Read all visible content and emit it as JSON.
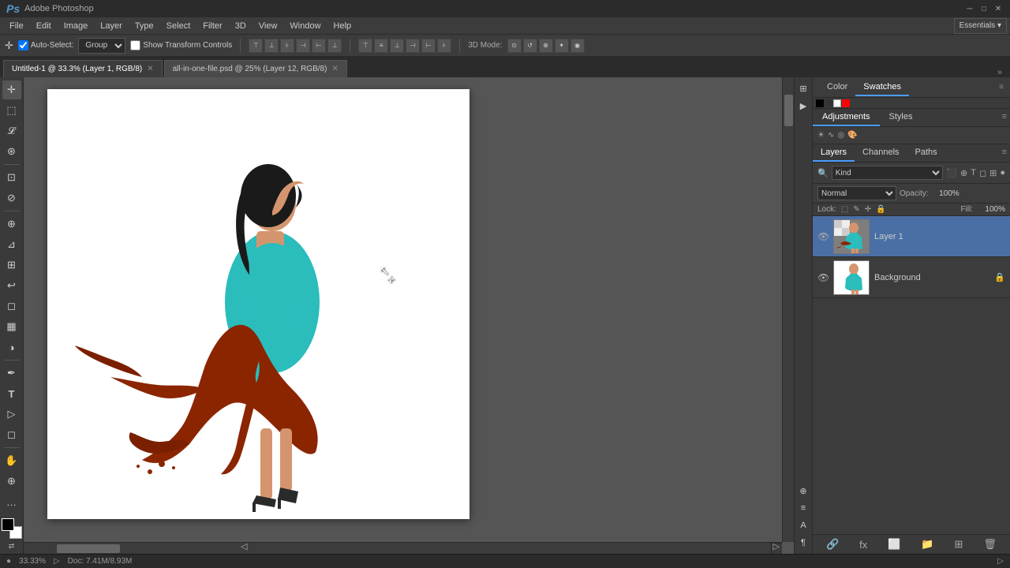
{
  "app": {
    "logo": "Ps",
    "title": "Adobe Photoshop",
    "essentials": "Essentials ▾"
  },
  "menubar": {
    "items": [
      "File",
      "Edit",
      "Image",
      "Layer",
      "Type",
      "Select",
      "Filter",
      "3D",
      "View",
      "Window",
      "Help"
    ]
  },
  "optionsbar": {
    "tool_icon": "⊕",
    "auto_select_label": "Auto-Select:",
    "auto_select_value": "Group",
    "show_transform": "Show Transform Controls",
    "model_3d_label": "3D Mode:"
  },
  "tabs": [
    {
      "label": "Untitled-1 @ 33.3% (Layer 1, RGB/8)",
      "active": true,
      "closable": true
    },
    {
      "label": "all-in-one-file.psd @ 25% (Layer 12, RGB/8)",
      "active": false,
      "closable": true
    }
  ],
  "panels": {
    "top_tabs": [
      "Color",
      "Swatches"
    ],
    "active_top_tab": "Swatches",
    "adj_tabs": [
      "Adjustments",
      "Styles"
    ],
    "active_adj_tab": "Adjustments",
    "layers_tabs": [
      "Layers",
      "Channels",
      "Paths"
    ],
    "active_layers_tab": "Layers",
    "filter_kind": "Kind",
    "blend_mode": "Normal",
    "opacity_label": "Opacity:",
    "opacity_value": "100%",
    "lock_label": "Lock:",
    "fill_label": "Fill:",
    "fill_value": "100%",
    "layers": [
      {
        "name": "Layer 1",
        "visible": true,
        "active": true,
        "locked": false
      },
      {
        "name": "Background",
        "visible": true,
        "active": false,
        "locked": true
      }
    ]
  },
  "statusbar": {
    "zoom": "33.33%",
    "doc_info": "Doc: 7.41M/8.93M"
  },
  "toolbar": {
    "tools": [
      {
        "name": "move",
        "icon": "✛",
        "title": "Move Tool"
      },
      {
        "name": "select-rect",
        "icon": "⬚",
        "title": "Rectangular Marquee"
      },
      {
        "name": "lasso",
        "icon": "⌗",
        "title": "Lasso Tool"
      },
      {
        "name": "quick-select",
        "icon": "⊛",
        "title": "Quick Selection"
      },
      {
        "name": "crop",
        "icon": "⊡",
        "title": "Crop Tool"
      },
      {
        "name": "eyedropper",
        "icon": "⊘",
        "title": "Eyedropper"
      },
      {
        "name": "heal",
        "icon": "⊕",
        "title": "Healing Brush"
      },
      {
        "name": "brush",
        "icon": "⊿",
        "title": "Brush Tool"
      },
      {
        "name": "stamp",
        "icon": "⊞",
        "title": "Clone Stamp"
      },
      {
        "name": "eraser",
        "icon": "◻",
        "title": "Eraser Tool"
      },
      {
        "name": "gradient",
        "icon": "▦",
        "title": "Gradient Tool"
      },
      {
        "name": "dodge",
        "icon": "◑",
        "title": "Dodge Tool"
      },
      {
        "name": "pen",
        "icon": "✒",
        "title": "Pen Tool"
      },
      {
        "name": "text",
        "icon": "T",
        "title": "Type Tool"
      },
      {
        "name": "path-select",
        "icon": "⊳",
        "title": "Path Selection"
      },
      {
        "name": "shape",
        "icon": "◻",
        "title": "Shape Tool"
      },
      {
        "name": "hand",
        "icon": "✋",
        "title": "Hand Tool"
      },
      {
        "name": "zoom",
        "icon": "⊕",
        "title": "Zoom Tool"
      },
      {
        "name": "more",
        "icon": "…",
        "title": "More Tools"
      }
    ]
  }
}
